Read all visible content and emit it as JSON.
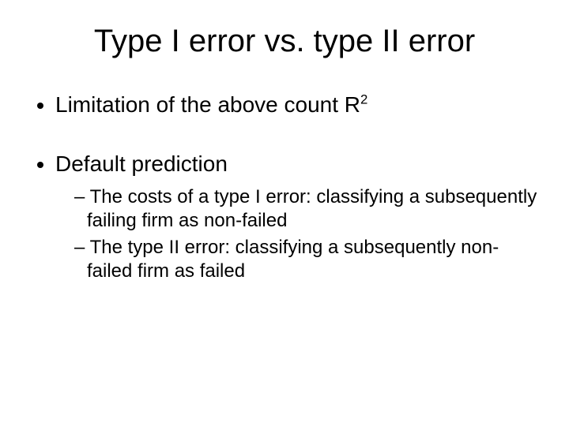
{
  "title": "Type I error vs. type II error",
  "bullets": {
    "b1_pre": "Limitation of the above count R",
    "b1_sup": "2",
    "b2": "Default prediction",
    "b2_sub1": "The costs of a type I error: classifying a subsequently failing firm as non-failed",
    "b2_sub2": "The type II error: classifying a subsequently non-failed firm as failed"
  }
}
